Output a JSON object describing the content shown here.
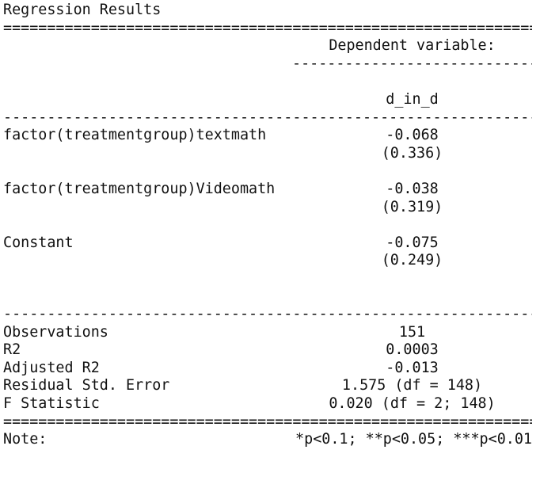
{
  "title": "Regression Results",
  "rules": {
    "double": "=======================================================================",
    "single": "-----------------------------------------------------------------------",
    "sub": "--------------------------------"
  },
  "header": {
    "dependent_label": "Dependent variable:",
    "dependent_name": "d_in_d"
  },
  "coefficients": [
    {
      "name": "factor(treatmentgroup)textmath",
      "estimate": "-0.068",
      "se": "(0.336)"
    },
    {
      "name": "factor(treatmentgroup)Videomath",
      "estimate": "-0.038",
      "se": "(0.319)"
    },
    {
      "name": "Constant",
      "estimate": "-0.075",
      "se": "(0.249)"
    }
  ],
  "stats": [
    {
      "name": "Observations",
      "value": "151"
    },
    {
      "name": "R2",
      "value": "0.0003"
    },
    {
      "name": "Adjusted R2",
      "value": "-0.013"
    },
    {
      "name": "Residual Std. Error",
      "value": "1.575 (df = 148)"
    },
    {
      "name": "F Statistic",
      "value": "0.020 (df = 2; 148)"
    }
  ],
  "note": {
    "label": "Note:",
    "text": "*p<0.1; **p<0.05; ***p<0.01"
  }
}
